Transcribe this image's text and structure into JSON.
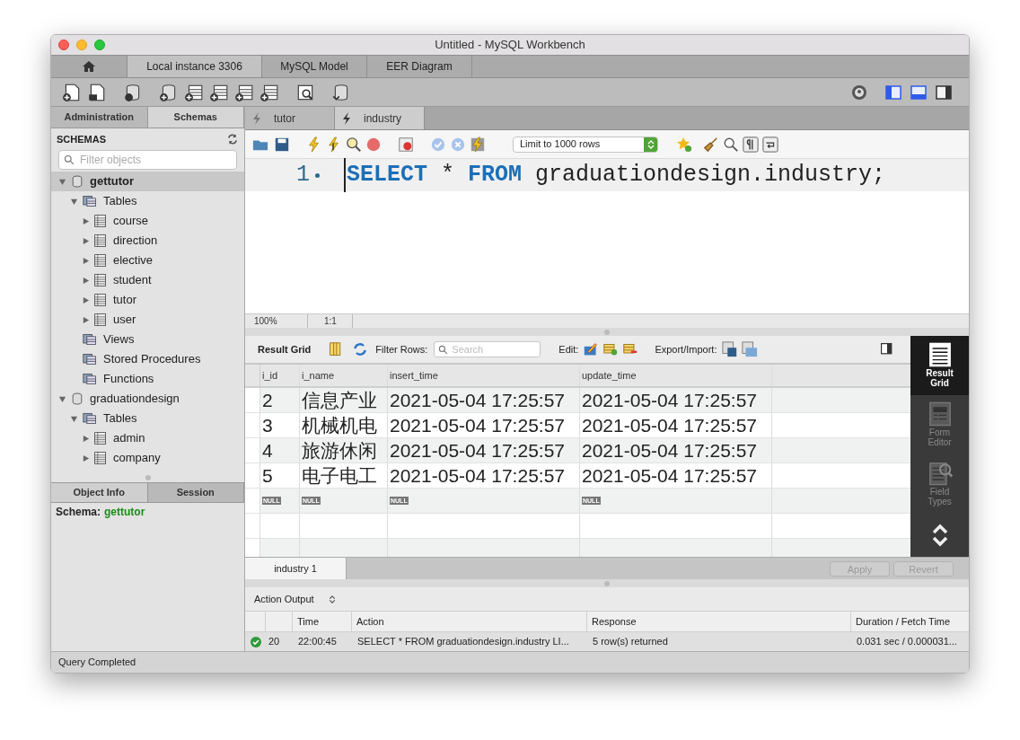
{
  "window": {
    "title": "Untitled - MySQL Workbench"
  },
  "app_tabs": [
    {
      "label": "Local instance 3306",
      "selected": true
    },
    {
      "label": "MySQL Model",
      "selected": false
    },
    {
      "label": "EER Diagram",
      "selected": false
    }
  ],
  "layout_toggles": [
    {
      "kind": "sidebar",
      "on": true
    },
    {
      "kind": "output",
      "on": true
    },
    {
      "kind": "secondary",
      "on": false
    }
  ],
  "sidebar": {
    "tabs": [
      {
        "label": "Administration",
        "selected": false
      },
      {
        "label": "Schemas",
        "selected": true
      }
    ],
    "header": "SCHEMAS",
    "filter": {
      "placeholder": "Filter objects"
    },
    "tree": [
      {
        "label": "gettutor",
        "kind": "schema",
        "expanded": true,
        "selected": true,
        "children": [
          {
            "label": "Tables",
            "kind": "group",
            "expanded": true,
            "selected": false,
            "children": [
              {
                "label": "course",
                "kind": "table",
                "expanded": false,
                "selected": false
              },
              {
                "label": "direction",
                "kind": "table",
                "expanded": false,
                "selected": false
              },
              {
                "label": "elective",
                "kind": "table",
                "expanded": false,
                "selected": false
              },
              {
                "label": "student",
                "kind": "table",
                "expanded": false,
                "selected": false
              },
              {
                "label": "tutor",
                "kind": "table",
                "expanded": false,
                "selected": false
              },
              {
                "label": "user",
                "kind": "table",
                "expanded": false,
                "selected": false
              }
            ]
          },
          {
            "label": "Views",
            "kind": "group",
            "selected": false
          },
          {
            "label": "Stored Procedures",
            "kind": "group",
            "selected": false
          },
          {
            "label": "Functions",
            "kind": "group",
            "selected": false
          }
        ]
      },
      {
        "label": "graduationdesign",
        "kind": "schema",
        "expanded": true,
        "selected": false,
        "children": [
          {
            "label": "Tables",
            "kind": "group",
            "expanded": true,
            "selected": false,
            "children": [
              {
                "label": "admin",
                "kind": "table",
                "expanded": false,
                "selected": false
              },
              {
                "label": "company",
                "kind": "table",
                "expanded": false,
                "selected": false
              }
            ]
          }
        ]
      }
    ],
    "info_tabs": [
      {
        "label": "Object Info",
        "selected": true
      },
      {
        "label": "Session",
        "selected": false
      }
    ],
    "info": {
      "label": "Schema:",
      "value": "gettutor"
    }
  },
  "editor": {
    "tabs": [
      {
        "label": "tutor",
        "selected": false
      },
      {
        "label": "industry",
        "selected": true
      }
    ],
    "limit": "Limit to 1000 rows",
    "line_number": "1",
    "code": [
      {
        "text": "SELECT",
        "kind": "keyword"
      },
      {
        "text": " * ",
        "kind": "plain"
      },
      {
        "text": "FROM",
        "kind": "keyword"
      },
      {
        "text": " graduationdesign.industry;",
        "kind": "plain"
      }
    ],
    "zoom": "100%",
    "position": "1:1"
  },
  "results": {
    "toolbar": {
      "title": "Result Grid",
      "filter_label": "Filter Rows:",
      "search_placeholder": "Search",
      "edit_label": "Edit:",
      "export_label": "Export/Import:"
    },
    "columns": [
      "i_id",
      "i_name",
      "insert_time",
      "update_time"
    ],
    "rows": [
      [
        "2",
        "信息产业",
        "2021-05-04 17:25:57",
        "2021-05-04 17:25:57"
      ],
      [
        "3",
        "机械机电",
        "2021-05-04 17:25:57",
        "2021-05-04 17:25:57"
      ],
      [
        "4",
        "旅游休闲",
        "2021-05-04 17:25:57",
        "2021-05-04 17:25:57"
      ],
      [
        "5",
        "电子电工",
        "2021-05-04 17:25:57",
        "2021-05-04 17:25:57"
      ]
    ],
    "null_row": [
      "NULL",
      "NULL",
      "NULL",
      "NULL"
    ],
    "side_panel": [
      {
        "label": "Result Grid",
        "kind": "grid",
        "selected": true
      },
      {
        "label": "Form Editor",
        "kind": "form",
        "selected": false
      },
      {
        "label": "Field Types",
        "kind": "fields",
        "selected": false
      }
    ],
    "result_tabs": [
      {
        "label": "industry 1",
        "selected": true
      }
    ],
    "buttons": [
      {
        "label": "Apply",
        "disabled": true
      },
      {
        "label": "Revert",
        "disabled": true
      }
    ]
  },
  "output": {
    "selector": "Action Output",
    "columns": [
      "Time",
      "Action",
      "Response",
      "Duration / Fetch Time"
    ],
    "rows": [
      {
        "succeeded": true,
        "number": "20",
        "time": "22:00:45",
        "action": "SELECT * FROM graduationdesign.industry LI...",
        "response": "5 row(s) returned",
        "duration": "0.031 sec / 0.000031..."
      }
    ]
  },
  "status_bar": "Query Completed"
}
